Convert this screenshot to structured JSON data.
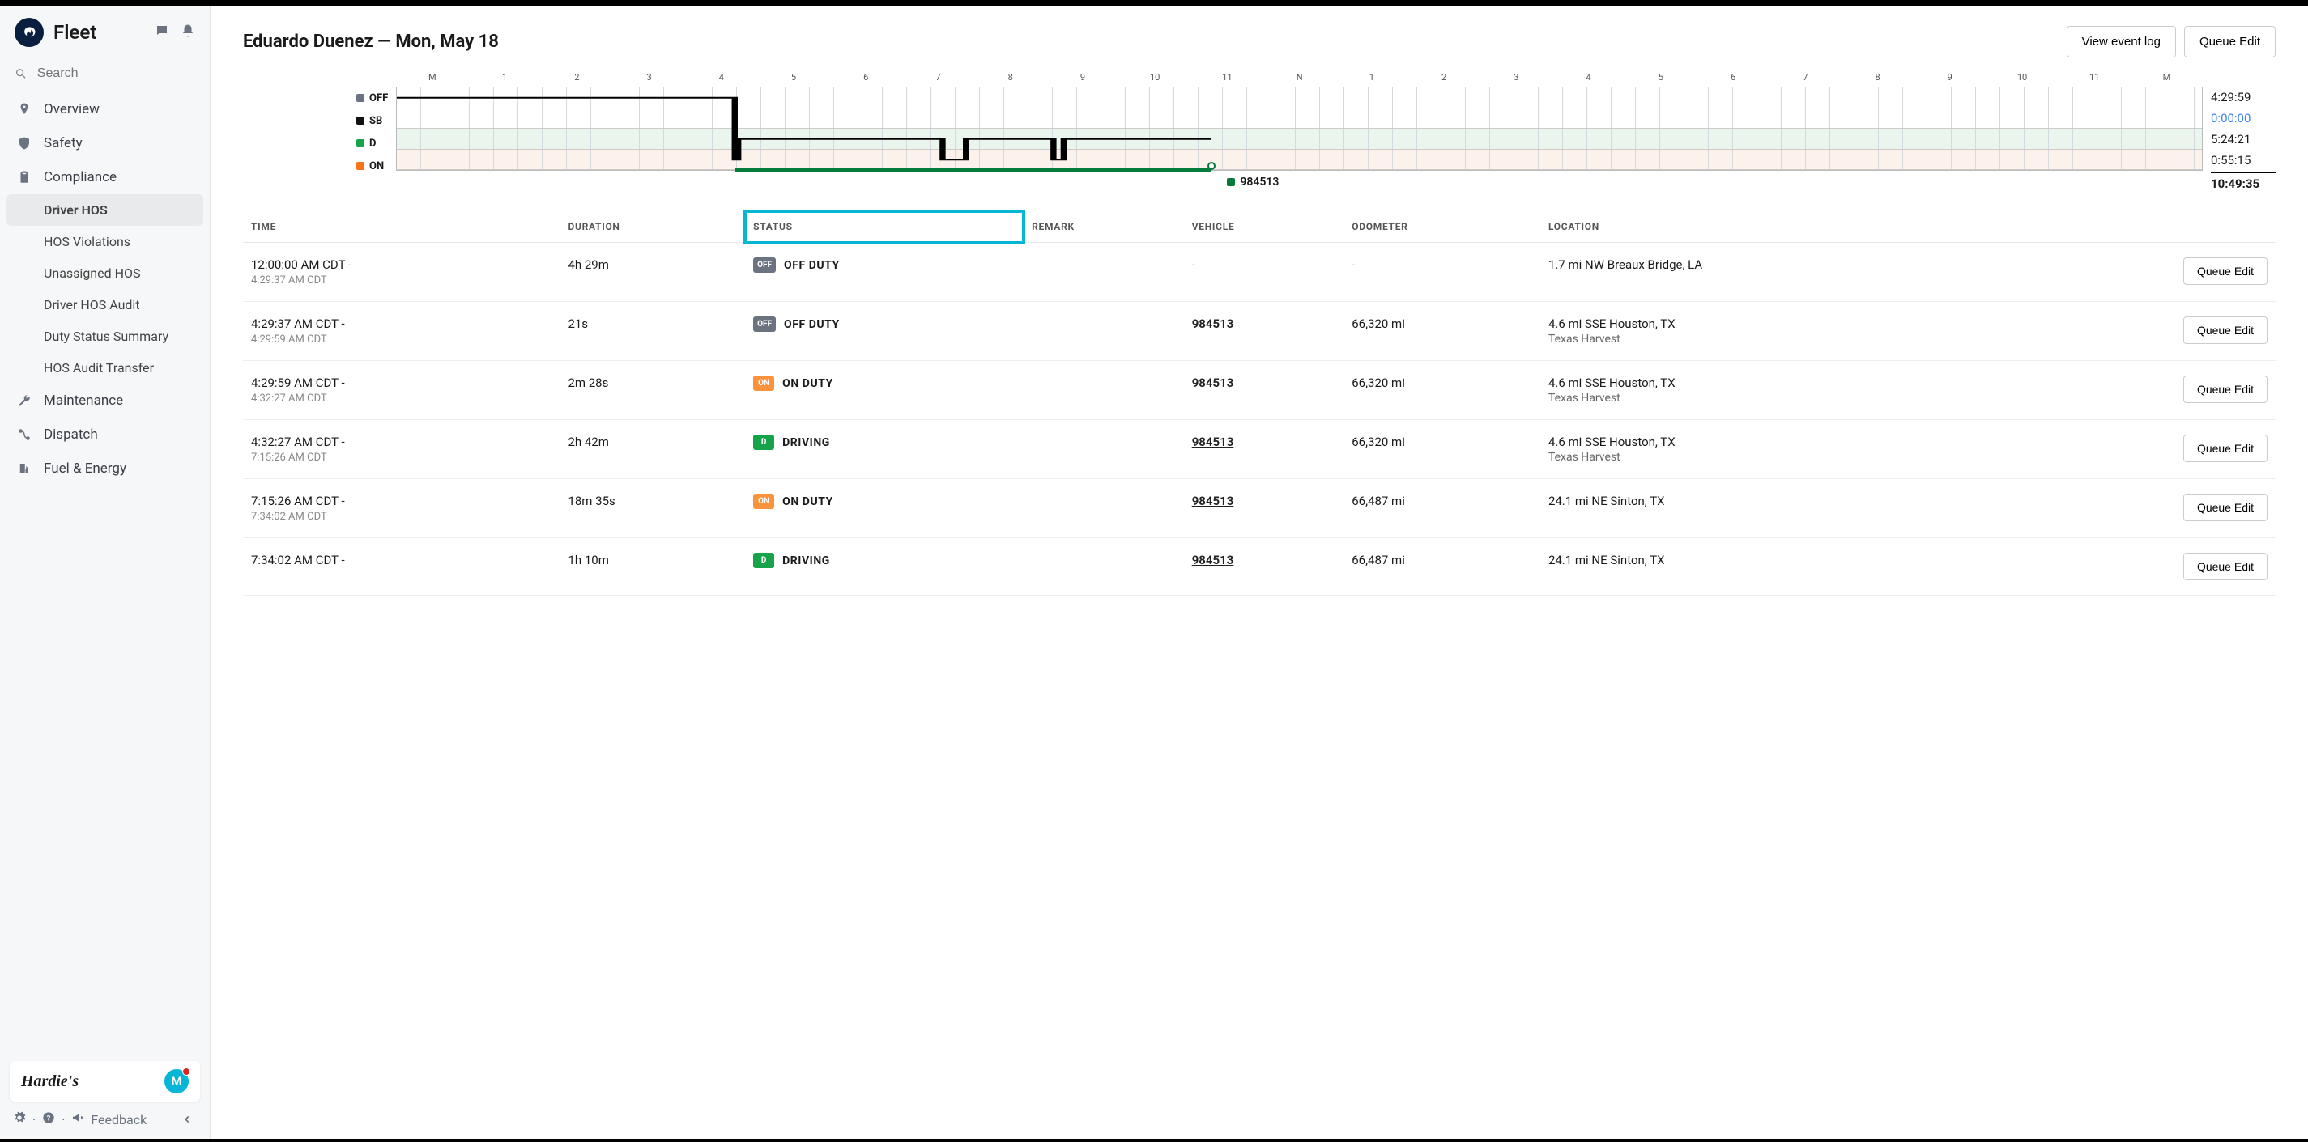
{
  "brand": "Fleet",
  "search_placeholder": "Search",
  "sidebar": {
    "items": [
      {
        "label": "Overview",
        "icon": "map-pin"
      },
      {
        "label": "Safety",
        "icon": "shield"
      },
      {
        "label": "Compliance",
        "icon": "clipboard",
        "expanded": true,
        "children": [
          {
            "label": "Driver HOS",
            "active": true
          },
          {
            "label": "HOS Violations"
          },
          {
            "label": "Unassigned HOS"
          },
          {
            "label": "Driver HOS Audit"
          },
          {
            "label": "Duty Status Summary"
          },
          {
            "label": "HOS Audit Transfer"
          }
        ]
      },
      {
        "label": "Maintenance",
        "icon": "wrench"
      },
      {
        "label": "Dispatch",
        "icon": "route"
      },
      {
        "label": "Fuel & Energy",
        "icon": "fuel"
      }
    ],
    "org_name": "Hardie's",
    "avatar_letter": "M",
    "feedback_label": "Feedback"
  },
  "page": {
    "title": "Eduardo Duenez — Mon, May 18",
    "actions": {
      "view_log": "View event log",
      "queue_edit": "Queue Edit"
    }
  },
  "chart_data": {
    "type": "timeline",
    "x_ticks": [
      "M",
      "1",
      "2",
      "3",
      "4",
      "5",
      "6",
      "7",
      "8",
      "9",
      "10",
      "11",
      "N",
      "1",
      "2",
      "3",
      "4",
      "5",
      "6",
      "7",
      "8",
      "9",
      "10",
      "11",
      "M"
    ],
    "rows": [
      {
        "key": "OFF",
        "label": "OFF",
        "color": "#6b7280",
        "total": "4:29:59"
      },
      {
        "key": "SB",
        "label": "SB",
        "color": "#111111",
        "total": "0:00:00"
      },
      {
        "key": "D",
        "label": "D",
        "color": "#16a34a",
        "total": "5:24:21"
      },
      {
        "key": "ON",
        "label": "ON",
        "color": "#f97316",
        "total": "0:55:15"
      }
    ],
    "grand_total": "10:49:35",
    "vehicle": "984513",
    "segments": [
      {
        "status": "OFF",
        "start_h": 0.0,
        "end_h": 4.4933
      },
      {
        "status": "ON",
        "start_h": 4.4933,
        "end_h": 4.5408
      },
      {
        "status": "D",
        "start_h": 4.5408,
        "end_h": 7.2572
      },
      {
        "status": "ON",
        "start_h": 7.2572,
        "end_h": 7.5672
      },
      {
        "status": "D",
        "start_h": 7.5672,
        "end_h": 8.7317
      },
      {
        "status": "ON",
        "start_h": 8.7317,
        "end_h": 8.8667
      },
      {
        "status": "D",
        "start_h": 8.8667,
        "end_h": 10.8264
      }
    ],
    "vehicle_bar": {
      "start_h": 4.4933,
      "end_h": 10.8264
    }
  },
  "table": {
    "headers": [
      "TIME",
      "DURATION",
      "STATUS",
      "REMARK",
      "VEHICLE",
      "ODOMETER",
      "LOCATION",
      ""
    ],
    "highlight_header_index": 2,
    "row_action": "Queue Edit",
    "status_styles": {
      "OFF DUTY": {
        "badge": "OFF",
        "bg": "#6b7280"
      },
      "ON DUTY": {
        "badge": "ON",
        "bg": "#fb923c"
      },
      "DRIVING": {
        "badge": "D",
        "bg": "#16a34a"
      }
    },
    "rows": [
      {
        "time_start": "12:00:00 AM CDT -",
        "time_end": "4:29:37 AM CDT",
        "duration": "4h 29m",
        "status": "OFF DUTY",
        "remark": "",
        "vehicle": "-",
        "odometer": "-",
        "location": "1.7 mi NW Breaux Bridge, LA",
        "location_sub": ""
      },
      {
        "time_start": "4:29:37 AM CDT -",
        "time_end": "4:29:59 AM CDT",
        "duration": "21s",
        "status": "OFF DUTY",
        "remark": "",
        "vehicle": "984513",
        "odometer": "66,320 mi",
        "location": "4.6 mi SSE Houston, TX",
        "location_sub": "Texas Harvest"
      },
      {
        "time_start": "4:29:59 AM CDT -",
        "time_end": "4:32:27 AM CDT",
        "duration": "2m 28s",
        "status": "ON DUTY",
        "remark": "",
        "vehicle": "984513",
        "odometer": "66,320 mi",
        "location": "4.6 mi SSE Houston, TX",
        "location_sub": "Texas Harvest"
      },
      {
        "time_start": "4:32:27 AM CDT -",
        "time_end": "7:15:26 AM CDT",
        "duration": "2h 42m",
        "status": "DRIVING",
        "remark": "",
        "vehicle": "984513",
        "odometer": "66,320 mi",
        "location": "4.6 mi SSE Houston, TX",
        "location_sub": "Texas Harvest"
      },
      {
        "time_start": "7:15:26 AM CDT -",
        "time_end": "7:34:02 AM CDT",
        "duration": "18m 35s",
        "status": "ON DUTY",
        "remark": "",
        "vehicle": "984513",
        "odometer": "66,487 mi",
        "location": "24.1 mi NE Sinton, TX",
        "location_sub": ""
      },
      {
        "time_start": "7:34:02 AM CDT -",
        "time_end": "",
        "duration": "1h 10m",
        "status": "DRIVING",
        "remark": "",
        "vehicle": "984513",
        "odometer": "66,487 mi",
        "location": "24.1 mi NE Sinton, TX",
        "location_sub": ""
      }
    ]
  }
}
